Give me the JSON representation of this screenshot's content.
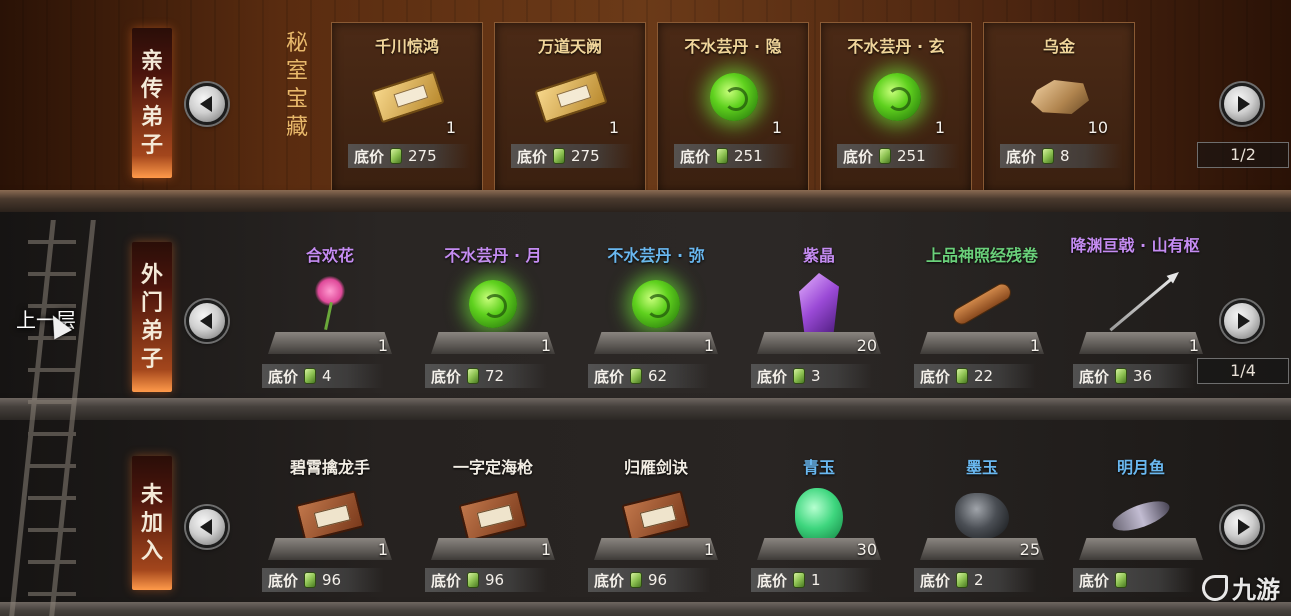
{
  "upstairs_label": "上一层",
  "watermark": "九游",
  "rows": [
    {
      "category": [
        "亲",
        "传",
        "弟",
        "子"
      ],
      "title": [
        "秘",
        "室",
        "宝",
        "藏"
      ],
      "page": "1/2",
      "items": [
        {
          "name": "千川惊鸿",
          "qty": "1",
          "price_label": "底价",
          "price": "275",
          "icon": "scroll-gold-icon",
          "color": "#f0d59a"
        },
        {
          "name": "万道天阙",
          "qty": "1",
          "price_label": "底价",
          "price": "275",
          "icon": "scroll-gold-icon",
          "color": "#f0d59a"
        },
        {
          "name": "不水芸丹 · 隐",
          "qty": "1",
          "price_label": "底价",
          "price": "251",
          "icon": "green-orb-icon",
          "color": "#f0d59a"
        },
        {
          "name": "不水芸丹 · 玄",
          "qty": "1",
          "price_label": "底价",
          "price": "251",
          "icon": "green-orb-icon",
          "color": "#f0d59a"
        },
        {
          "name": "乌金",
          "qty": "10",
          "price_label": "底价",
          "price": "8",
          "icon": "gold-ore-icon",
          "color": "#f0d59a"
        }
      ]
    },
    {
      "category": [
        "外",
        "门",
        "弟",
        "子"
      ],
      "page": "1/4",
      "items": [
        {
          "name": "合欢花",
          "qty": "1",
          "price_label": "底价",
          "price": "4",
          "icon": "flower-icon",
          "color": "#c58cf2"
        },
        {
          "name": "不水芸丹 · 月",
          "qty": "1",
          "price_label": "底价",
          "price": "72",
          "icon": "green-orb-icon",
          "color": "#c58cf2"
        },
        {
          "name": "不水芸丹 · 弥",
          "qty": "1",
          "price_label": "底价",
          "price": "62",
          "icon": "green-orb-icon",
          "color": "#6ab8f0"
        },
        {
          "name": "紫晶",
          "qty": "20",
          "price_label": "底价",
          "price": "3",
          "icon": "purple-crystal-icon",
          "color": "#c58cf2"
        },
        {
          "name": "上品神照经残卷",
          "qty": "1",
          "price_label": "底价",
          "price": "22",
          "icon": "scroll-roll-icon",
          "color": "#6ad07a"
        },
        {
          "name": "降渊亘戟 · 山有枢",
          "qty": "1",
          "price_label": "底价",
          "price": "36",
          "icon": "spear-icon",
          "color": "#c58cf2"
        }
      ]
    },
    {
      "category": [
        "未",
        "加",
        "入"
      ],
      "items": [
        {
          "name": "碧霄擒龙手",
          "qty": "1",
          "price_label": "底价",
          "price": "96",
          "icon": "book-icon",
          "color": "#f2ede4"
        },
        {
          "name": "一字定海枪",
          "qty": "1",
          "price_label": "底价",
          "price": "96",
          "icon": "book-icon",
          "color": "#f2ede4"
        },
        {
          "name": "归雁剑诀",
          "qty": "1",
          "price_label": "底价",
          "price": "96",
          "icon": "book-icon",
          "color": "#f2ede4"
        },
        {
          "name": "青玉",
          "qty": "30",
          "price_label": "底价",
          "price": "1",
          "icon": "green-jade-icon",
          "color": "#6ab8f0"
        },
        {
          "name": "墨玉",
          "qty": "25",
          "price_label": "底价",
          "price": "2",
          "icon": "ink-jade-icon",
          "color": "#6ab8f0"
        },
        {
          "name": "明月鱼",
          "qty": "",
          "price_label": "底价",
          "price": "",
          "icon": "fish-icon",
          "color": "#6ab8f0"
        }
      ]
    }
  ]
}
